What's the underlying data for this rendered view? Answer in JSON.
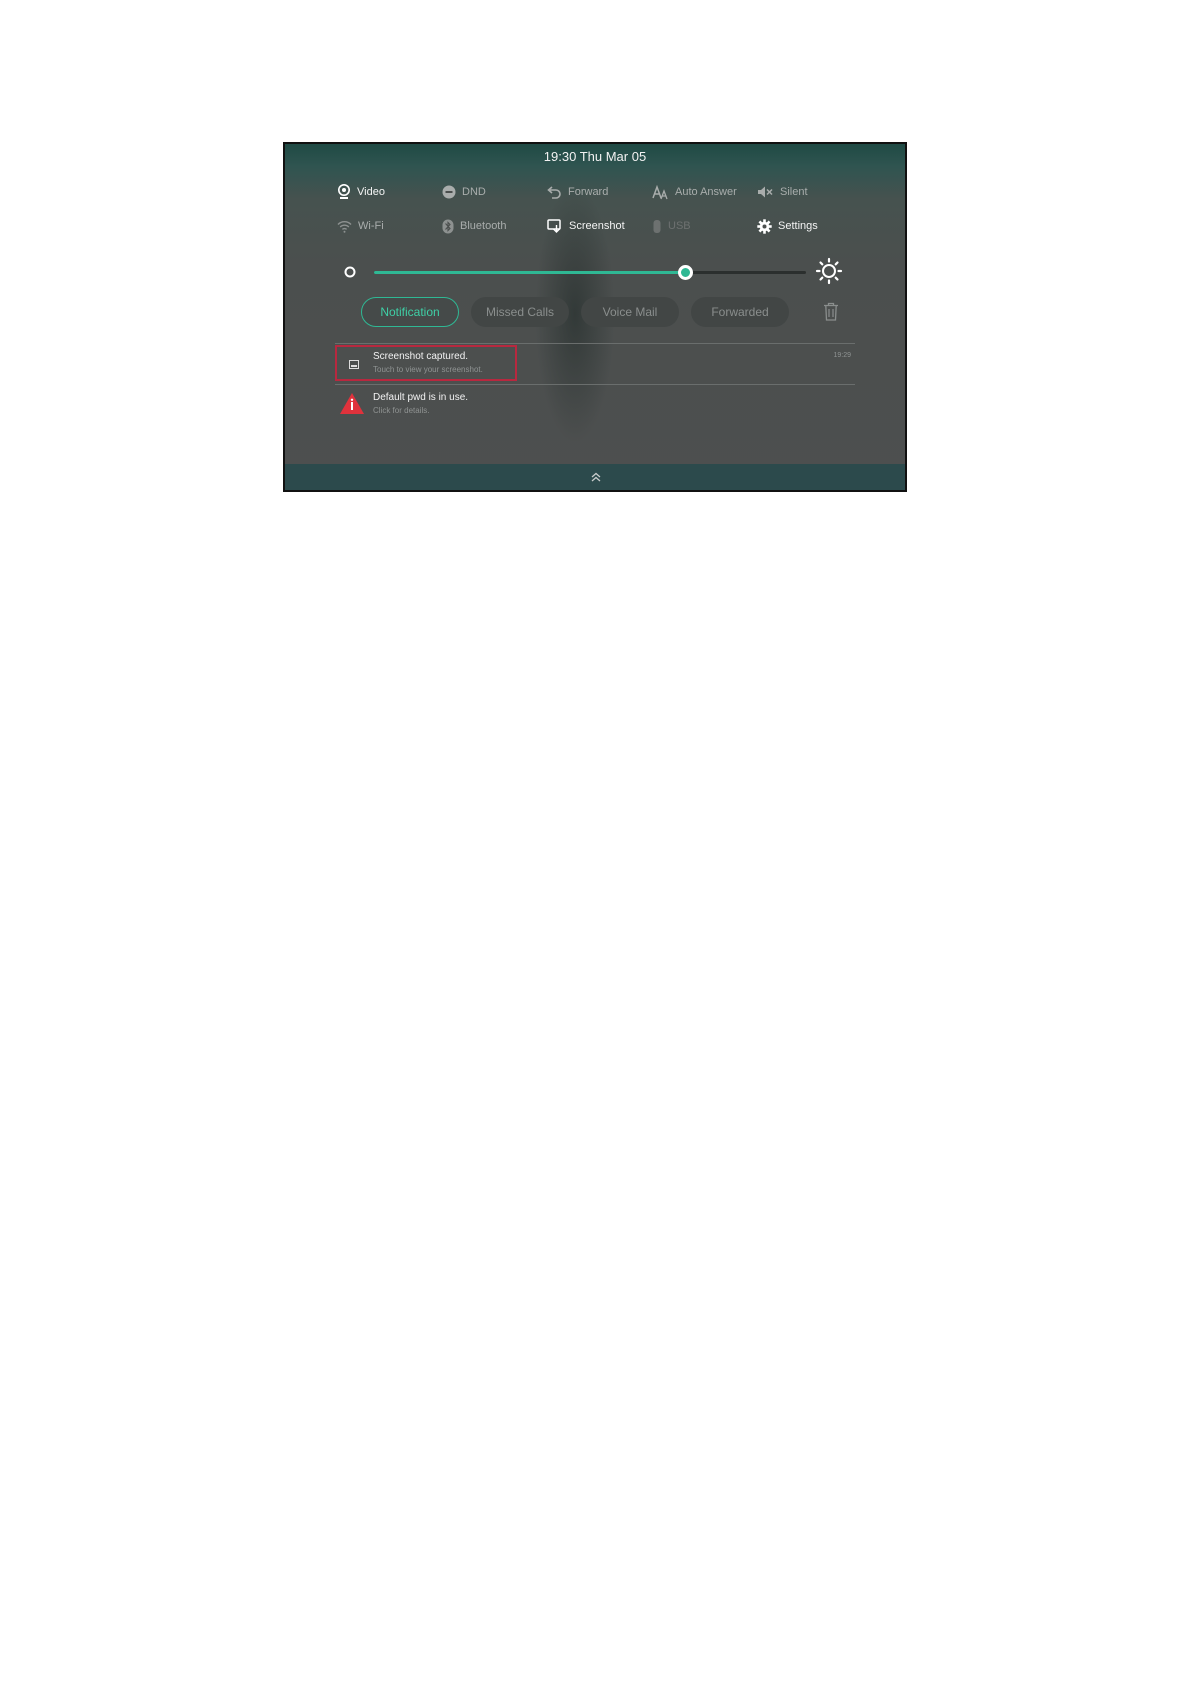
{
  "status": {
    "time_date": "19:30 Thu Mar 05"
  },
  "quick_settings": {
    "row1": [
      {
        "label": "Video",
        "icon": "video-icon",
        "state": "on"
      },
      {
        "label": "DND",
        "icon": "dnd-icon",
        "state": "dim"
      },
      {
        "label": "Forward",
        "icon": "forward-icon",
        "state": "dim"
      },
      {
        "label": "Auto Answer",
        "icon": "auto-answer-icon",
        "state": "dim"
      },
      {
        "label": "Silent",
        "icon": "silent-icon",
        "state": "dim"
      }
    ],
    "row2": [
      {
        "label": "Wi-Fi",
        "icon": "wifi-icon",
        "state": "dim"
      },
      {
        "label": "Bluetooth",
        "icon": "bluetooth-icon",
        "state": "dim"
      },
      {
        "label": "Screenshot",
        "icon": "screenshot-icon",
        "state": "on"
      },
      {
        "label": "USB",
        "icon": "usb-icon",
        "state": "off"
      },
      {
        "label": "Settings",
        "icon": "gear-icon",
        "state": "on"
      }
    ]
  },
  "brightness": {
    "level_percent": 72,
    "accent_color": "#2fb894"
  },
  "tabs": [
    {
      "label": "Notification",
      "active": true
    },
    {
      "label": "Missed Calls",
      "active": false
    },
    {
      "label": "Voice Mail",
      "active": false
    },
    {
      "label": "Forwarded",
      "active": false
    }
  ],
  "notifications": [
    {
      "title": "Screenshot captured.",
      "subtitle": "Touch to view your screenshot.",
      "time": "19:29",
      "icon": "image-icon"
    },
    {
      "title": "Default pwd is in use.",
      "subtitle": "Click for details.",
      "time": "",
      "icon": "warning-icon"
    }
  ],
  "colors": {
    "highlight_box": "#b8283f",
    "warning": "#e0323c"
  }
}
